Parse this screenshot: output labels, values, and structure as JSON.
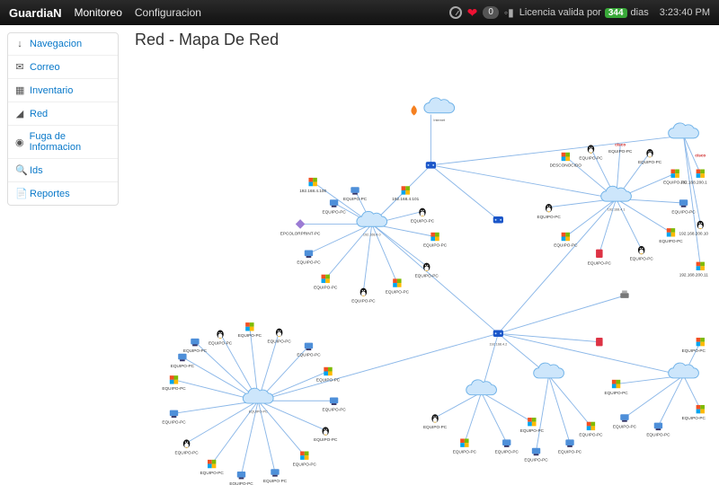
{
  "navbar": {
    "brand": "GuardiaN",
    "links": {
      "monitoreo": "Monitoreo",
      "configuracion": "Configuracion"
    },
    "badge_count": "0",
    "license_prefix": "Licencia valida por",
    "license_days_badge": "344",
    "license_suffix": "dias",
    "time": "3:23:40 PM"
  },
  "sidebar": {
    "items": [
      {
        "icon": "↓",
        "label": "Navegacion"
      },
      {
        "icon": "✉",
        "label": "Correo"
      },
      {
        "icon": "▦",
        "label": "Inventario"
      },
      {
        "icon": "◢",
        "label": "Red"
      },
      {
        "icon": "◉",
        "label": "Fuga de Informacion"
      },
      {
        "icon": "🔍",
        "label": "Ids"
      },
      {
        "icon": "📄",
        "label": "Reportes"
      }
    ]
  },
  "page": {
    "title": "Red - Mapa De Red"
  },
  "map_labels": {
    "internet": "Internet",
    "ip_range_a": "192.168.4.0",
    "ip_range_b": "192.168.4.1",
    "center_ip": "192.168.4.2",
    "generic_host": "EQUIPO-PC",
    "cisco": "CISCO",
    "desconocido": "DESCONOCIDO",
    "printer": "EPCOLORPRINT-PC",
    "host_ip_sample": "192.168.200.1",
    "host_ip_sample2": "192.168.4.100",
    "host_ip_sample3": "192.168.4.101",
    "host_ip_sample4": "192.168.200.10",
    "host_ip_sample5": "192.168.200.11"
  }
}
